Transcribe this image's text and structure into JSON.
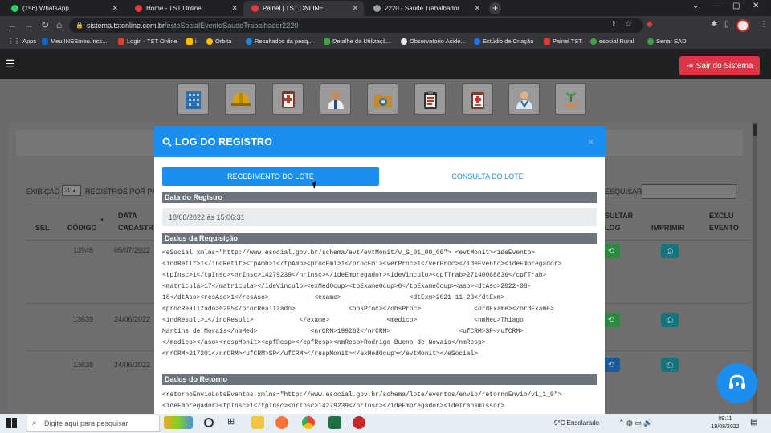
{
  "browser": {
    "tabs": [
      {
        "title": "(156) WhatsApp",
        "favicon_color": "#25d366",
        "active": false
      },
      {
        "title": "Home - TST Online",
        "favicon_color": "#e53935",
        "active": false
      },
      {
        "title": "Painel | TST ONLINE",
        "favicon_color": "#e53935",
        "active": true
      },
      {
        "title": "2220 - Saúde Trabalhador",
        "favicon_color": "#9aa0a6",
        "active": false
      }
    ],
    "url_host": "sistema.tstonline.com.br",
    "url_path": "/esteSocialEventoSaudeTrabalhador2220",
    "bookmarks": [
      {
        "label": "Apps",
        "color": "#e8eaed"
      },
      {
        "label": "Meu INSSmeu.inss...",
        "color": "#1565c0"
      },
      {
        "label": "Login - TST Online",
        "color": "#e53935"
      },
      {
        "label": "i",
        "color": "#fbbc04"
      },
      {
        "label": "Órbita",
        "color": "#fbbc04"
      },
      {
        "label": "Resultados da pesq...",
        "color": "#1e88e5"
      },
      {
        "label": "Detalhe da Utilizaçã...",
        "color": "#43a047"
      },
      {
        "label": "Observatorio Acide...",
        "color": "#e8eaed"
      },
      {
        "label": "Estúdio de Criação",
        "color": "#1877f2"
      },
      {
        "label": "Painel TST",
        "color": "#e53935"
      },
      {
        "label": "esocial Rural",
        "color": "#43a047"
      },
      {
        "label": "Senar EAD",
        "color": "#43a047"
      }
    ]
  },
  "app": {
    "logout_label": "Sair do Sistema",
    "menu_icons": [
      "building-icon",
      "safety-helmet-icon",
      "medical-report-icon",
      "doctor-icon",
      "folder-icon",
      "clipboard-icon",
      "checklist-icon",
      "nurse-icon",
      "plant-hands-icon"
    ]
  },
  "background_table": {
    "exibicao_label": "EXIBIÇÃO",
    "page_size": "20",
    "registros_label": "REGISTROS POR PÁ",
    "search_label": "ESQUISAR",
    "headers": [
      "SEL",
      "CÓDIGO",
      "DATA",
      "CADASTR",
      "SULTAR",
      "LOG",
      "IMPRIMIR",
      "EXCLU",
      "EVENTO"
    ],
    "rows": [
      {
        "codigo": "13946",
        "data": "05/07/2022"
      },
      {
        "codigo": "13639",
        "data": "24/06/2022"
      },
      {
        "codigo": "13638",
        "data": "24/06/2022"
      }
    ]
  },
  "modal": {
    "title": "LOG DO REGISTRO",
    "close": "×",
    "tab_receipt": "RECEBIMENTO DO LOTE",
    "tab_query": "CONSULTA DO LOTE",
    "section_date": "Data do Registro",
    "date_value": "18/08/2022 às 15:06:31",
    "section_request": "Dados da Requisição",
    "request_lines": [
      "<eSocial xmlns=\"http://www.esocial.gov.br/schema/evt/evtMonit/v_S_01_00_00\"> <evtMonit><ideEvento>",
      "<indRetif>1</indRetif><tpAmb>1</tpAmb><procEmi>1</procEmi><verProc>1</verProc></ideEvento><ideEmpregador>",
      "<tpInsc>1</tpInsc><nrInsc>14279239</nrInsc></ideEmpregador><ideVinculo><cpfTrab>27140088836</cpfTrab>",
      "<matricula>17</matricula></ideVinculo><exMedOcup><tpExameOcup>0</tpExameOcup><aso><dtAso>2022-08-",
      "18</dtAso><resAso>1</resAso>            <exame>                  <dtExm>2021-11-23</dtExm>",
      "<procRealizado>0295</procRealizado>              <obsProc></obsProc>              <ordExame></ordExame>",
      "<indResult>1</indResult>            </exame>               <medico>               <nmMed>Thiago",
      "Martins de Morais</nmMed>              <nrCRM>199262</nrCRM>                  <ufCRM>SP</ufCRM>",
      "</medico></aso><respMonit><cpfResp></cpfResp><nmResp>Rodrigo Bueno de Novais</nmResp>",
      "<nrCRM>217201</nrCRM><ufCRM>SP</ufCRM></respMonit></exMedOcup></evtMonit></eSocial>"
    ],
    "section_return": "Dados do Retorno",
    "return_lines": [
      "<retornoEnvioLoteEventos xmlns=\"http://www.esocial.gov.br/schema/lote/eventos/envio/retornoEnvio/v1_1_0\">",
      "<ideEmpregador><tpInsc>1</tpInsc><nrInsc>14279239</nrInsc></ideEmpregador><ideTransmissor>"
    ]
  },
  "taskbar": {
    "search_placeholder": "Digite aqui para pesquisar",
    "weather": "9°C  Ensolarado",
    "time": "09:11",
    "date": "19/08/2022"
  }
}
